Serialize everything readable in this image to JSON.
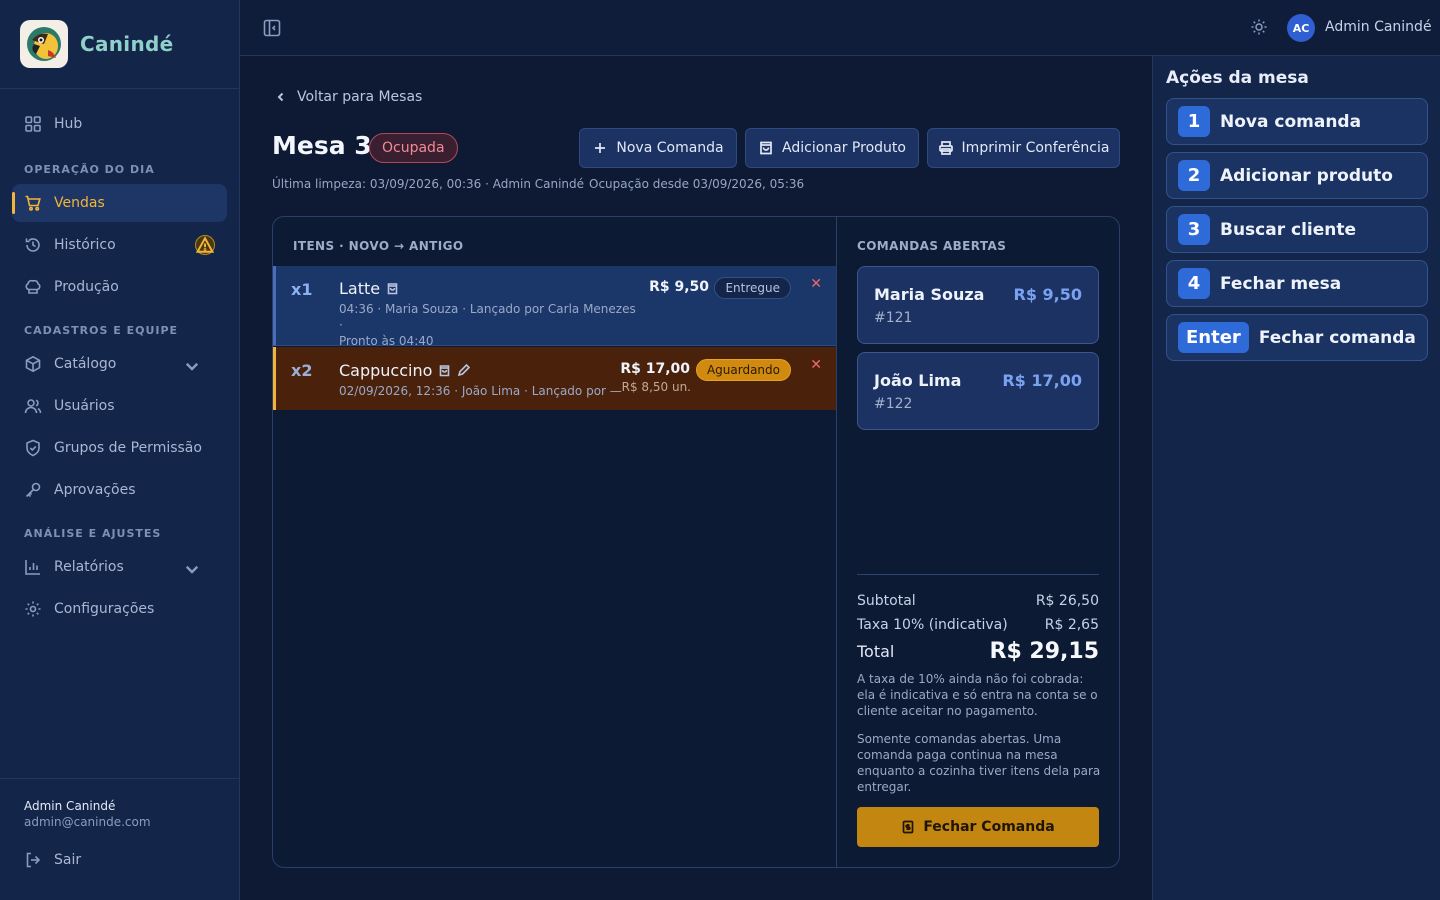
{
  "brand": {
    "name": "Canindé"
  },
  "sidebar": {
    "hub": "Hub",
    "section1": "OPERAÇÃO DO DIA",
    "vendas": "Vendas",
    "historico": "Histórico",
    "producao": "Produção",
    "section2": "CADASTROS E EQUIPE",
    "catalogo": "Catálogo",
    "usuarios": "Usuários",
    "grupos": "Grupos de Permissão",
    "aprovacoes": "Aprovações",
    "section3": "ANÁLISE E AJUSTES",
    "relatorios": "Relatórios",
    "configuracoes": "Configurações",
    "user_name": "Admin Canindé",
    "user_email": "admin@caninde.com",
    "logout": "Sair"
  },
  "topbar": {
    "avatar": "AC",
    "user": "Admin Canindé"
  },
  "page": {
    "back": "Voltar para Mesas",
    "title": "Mesa 3",
    "status": "Ocupada",
    "last_clean": "Última limpeza: 03/09/2026, 00:36 · Admin Canindé",
    "occupied_since": "Ocupação desde 03/09/2026, 05:36",
    "btn_nova": "Nova Comanda",
    "btn_adicionar": "Adicionar Produto",
    "btn_imprimir": "Imprimir Conferência"
  },
  "items": {
    "header": "ITENS · NOVO → ANTIGO",
    "list": [
      {
        "qty": "x1",
        "name": "Latte",
        "meta1": "04:36 · Maria Souza · Lançado por Carla Menezes ·",
        "meta2": "Pronto às 04:40",
        "price": "R$ 9,50",
        "unit": "",
        "status": "Entregue"
      },
      {
        "qty": "x2",
        "name": "Cappuccino",
        "meta1": "02/09/2026, 12:36 · João Lima · Lançado por —",
        "meta2": "",
        "price": "R$ 17,00",
        "unit": "R$ 8,50 un.",
        "status": "Aguardando"
      }
    ]
  },
  "comandas": {
    "header": "COMANDAS ABERTAS",
    "list": [
      {
        "name": "Maria Souza",
        "num": "#121",
        "value": "R$ 9,50"
      },
      {
        "name": "João Lima",
        "num": "#122",
        "value": "R$ 17,00"
      }
    ],
    "subtotal_label": "Subtotal",
    "subtotal": "R$ 26,50",
    "taxa_label": "Taxa 10% (indicativa)",
    "taxa": "R$ 2,65",
    "total_label": "Total",
    "total": "R$ 29,15",
    "note1": "A taxa de 10% ainda não foi cobrada: ela é indicativa e só entra na conta se o cliente aceitar no pagamento.",
    "note2": "Somente comandas abertas. Uma comanda paga continua na mesa enquanto a cozinha tiver itens dela para entregar.",
    "fechar": "Fechar Comanda"
  },
  "actions": {
    "title": "Ações da mesa",
    "list": [
      {
        "key": "1",
        "label": "Nova comanda"
      },
      {
        "key": "2",
        "label": "Adicionar produto"
      },
      {
        "key": "3",
        "label": "Buscar cliente"
      },
      {
        "key": "4",
        "label": "Fechar mesa"
      },
      {
        "key": "Enter",
        "label": "Fechar comanda"
      }
    ]
  }
}
